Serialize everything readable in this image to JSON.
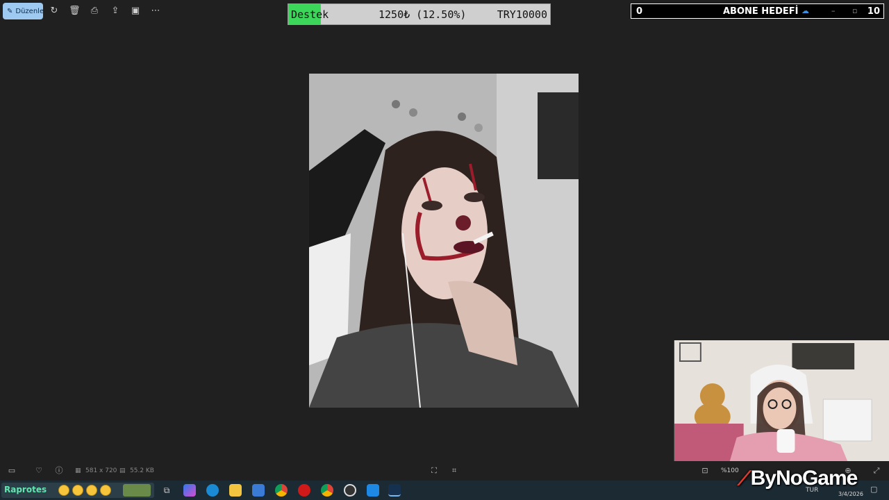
{
  "toolbar": {
    "edit_label": "Düzenle",
    "icons": [
      "edit-icon",
      "rotate-icon",
      "delete-icon",
      "print-icon",
      "share-icon",
      "slideshow-icon",
      "more-icon"
    ]
  },
  "donation": {
    "label": "Destek",
    "amount": "1250₺ (12.50%)",
    "goal": "TRY10000",
    "progress_fraction": 0.125,
    "fill_color": "#3cd65a"
  },
  "sub_goal": {
    "current": "0",
    "title": "ABONE HEDEFİ",
    "target": "10"
  },
  "statusbar": {
    "dimensions": "581 x 720",
    "file_size": "55.2 KB",
    "zoom": "%100"
  },
  "overlay": {
    "logo": "ByNoGame"
  },
  "taskbar": {
    "widget_text": "Raprotes",
    "language": "TUR",
    "date": "3/4/2026"
  }
}
